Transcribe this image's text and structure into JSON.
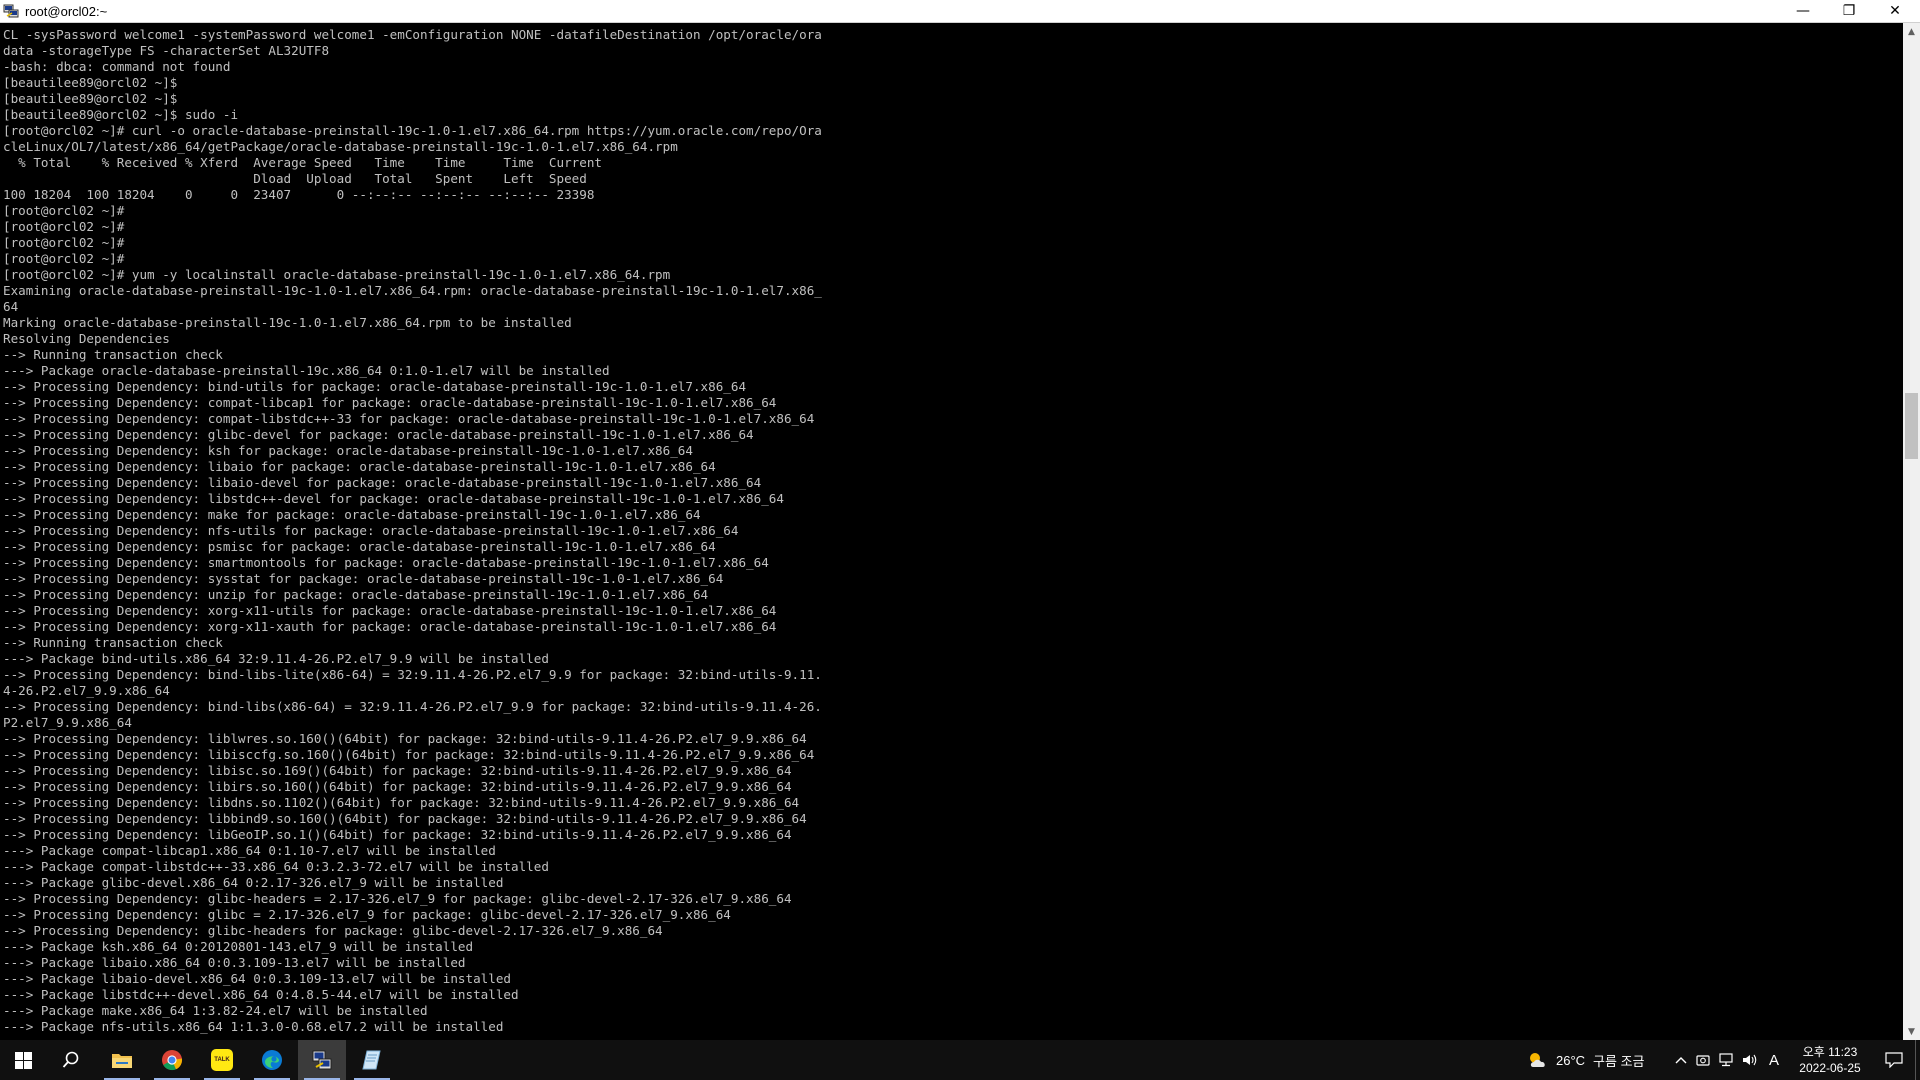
{
  "window": {
    "title": "root@orcl02:~",
    "minimize_glyph": "—",
    "maximize_glyph": "❐",
    "close_glyph": "✕"
  },
  "terminal": {
    "lines": [
      "CL -sysPassword welcome1 -systemPassword welcome1 -emConfiguration NONE -datafileDestination /opt/oracle/ora",
      "data -storageType FS -characterSet AL32UTF8",
      "-bash: dbca: command not found",
      "[beautilee89@orcl02 ~]$",
      "[beautilee89@orcl02 ~]$",
      "[beautilee89@orcl02 ~]$ sudo -i",
      "[root@orcl02 ~]# curl -o oracle-database-preinstall-19c-1.0-1.el7.x86_64.rpm https://yum.oracle.com/repo/Ora",
      "cleLinux/OL7/latest/x86_64/getPackage/oracle-database-preinstall-19c-1.0-1.el7.x86_64.rpm",
      "  % Total    % Received % Xferd  Average Speed   Time    Time     Time  Current",
      "                                 Dload  Upload   Total   Spent    Left  Speed",
      "100 18204  100 18204    0     0  23407      0 --:--:-- --:--:-- --:--:-- 23398",
      "[root@orcl02 ~]#",
      "[root@orcl02 ~]#",
      "[root@orcl02 ~]#",
      "[root@orcl02 ~]#",
      "[root@orcl02 ~]# yum -y localinstall oracle-database-preinstall-19c-1.0-1.el7.x86_64.rpm",
      "Examining oracle-database-preinstall-19c-1.0-1.el7.x86_64.rpm: oracle-database-preinstall-19c-1.0-1.el7.x86_",
      "64",
      "Marking oracle-database-preinstall-19c-1.0-1.el7.x86_64.rpm to be installed",
      "Resolving Dependencies",
      "--> Running transaction check",
      "---> Package oracle-database-preinstall-19c.x86_64 0:1.0-1.el7 will be installed",
      "--> Processing Dependency: bind-utils for package: oracle-database-preinstall-19c-1.0-1.el7.x86_64",
      "--> Processing Dependency: compat-libcap1 for package: oracle-database-preinstall-19c-1.0-1.el7.x86_64",
      "--> Processing Dependency: compat-libstdc++-33 for package: oracle-database-preinstall-19c-1.0-1.el7.x86_64",
      "--> Processing Dependency: glibc-devel for package: oracle-database-preinstall-19c-1.0-1.el7.x86_64",
      "--> Processing Dependency: ksh for package: oracle-database-preinstall-19c-1.0-1.el7.x86_64",
      "--> Processing Dependency: libaio for package: oracle-database-preinstall-19c-1.0-1.el7.x86_64",
      "--> Processing Dependency: libaio-devel for package: oracle-database-preinstall-19c-1.0-1.el7.x86_64",
      "--> Processing Dependency: libstdc++-devel for package: oracle-database-preinstall-19c-1.0-1.el7.x86_64",
      "--> Processing Dependency: make for package: oracle-database-preinstall-19c-1.0-1.el7.x86_64",
      "--> Processing Dependency: nfs-utils for package: oracle-database-preinstall-19c-1.0-1.el7.x86_64",
      "--> Processing Dependency: psmisc for package: oracle-database-preinstall-19c-1.0-1.el7.x86_64",
      "--> Processing Dependency: smartmontools for package: oracle-database-preinstall-19c-1.0-1.el7.x86_64",
      "--> Processing Dependency: sysstat for package: oracle-database-preinstall-19c-1.0-1.el7.x86_64",
      "--> Processing Dependency: unzip for package: oracle-database-preinstall-19c-1.0-1.el7.x86_64",
      "--> Processing Dependency: xorg-x11-utils for package: oracle-database-preinstall-19c-1.0-1.el7.x86_64",
      "--> Processing Dependency: xorg-x11-xauth for package: oracle-database-preinstall-19c-1.0-1.el7.x86_64",
      "--> Running transaction check",
      "---> Package bind-utils.x86_64 32:9.11.4-26.P2.el7_9.9 will be installed",
      "--> Processing Dependency: bind-libs-lite(x86-64) = 32:9.11.4-26.P2.el7_9.9 for package: 32:bind-utils-9.11.",
      "4-26.P2.el7_9.9.x86_64",
      "--> Processing Dependency: bind-libs(x86-64) = 32:9.11.4-26.P2.el7_9.9 for package: 32:bind-utils-9.11.4-26.",
      "P2.el7_9.9.x86_64",
      "--> Processing Dependency: liblwres.so.160()(64bit) for package: 32:bind-utils-9.11.4-26.P2.el7_9.9.x86_64",
      "--> Processing Dependency: libisccfg.so.160()(64bit) for package: 32:bind-utils-9.11.4-26.P2.el7_9.9.x86_64",
      "--> Processing Dependency: libisc.so.169()(64bit) for package: 32:bind-utils-9.11.4-26.P2.el7_9.9.x86_64",
      "--> Processing Dependency: libirs.so.160()(64bit) for package: 32:bind-utils-9.11.4-26.P2.el7_9.9.x86_64",
      "--> Processing Dependency: libdns.so.1102()(64bit) for package: 32:bind-utils-9.11.4-26.P2.el7_9.9.x86_64",
      "--> Processing Dependency: libbind9.so.160()(64bit) for package: 32:bind-utils-9.11.4-26.P2.el7_9.9.x86_64",
      "--> Processing Dependency: libGeoIP.so.1()(64bit) for package: 32:bind-utils-9.11.4-26.P2.el7_9.9.x86_64",
      "---> Package compat-libcap1.x86_64 0:1.10-7.el7 will be installed",
      "---> Package compat-libstdc++-33.x86_64 0:3.2.3-72.el7 will be installed",
      "---> Package glibc-devel.x86_64 0:2.17-326.el7_9 will be installed",
      "--> Processing Dependency: glibc-headers = 2.17-326.el7_9 for package: glibc-devel-2.17-326.el7_9.x86_64",
      "--> Processing Dependency: glibc = 2.17-326.el7_9 for package: glibc-devel-2.17-326.el7_9.x86_64",
      "--> Processing Dependency: glibc-headers for package: glibc-devel-2.17-326.el7_9.x86_64",
      "---> Package ksh.x86_64 0:20120801-143.el7_9 will be installed",
      "---> Package libaio.x86_64 0:0.3.109-13.el7 will be installed",
      "---> Package libaio-devel.x86_64 0:0.3.109-13.el7 will be installed",
      "---> Package libstdc++-devel.x86_64 0:4.8.5-44.el7 will be installed",
      "---> Package make.x86_64 1:3.82-24.el7 will be installed",
      "---> Package nfs-utils.x86_64 1:1.3.0-0.68.el7.2 will be installed"
    ]
  },
  "scrollbar": {
    "up_glyph": "▲",
    "down_glyph": "▼"
  },
  "taskbar": {
    "apps": [
      {
        "name": "start",
        "icon": "windows-logo-icon"
      },
      {
        "name": "search",
        "icon": "search-icon"
      },
      {
        "name": "file-explorer",
        "icon": "folder-icon"
      },
      {
        "name": "chrome",
        "icon": "chrome-icon"
      },
      {
        "name": "kakaotalk",
        "icon": "kakaotalk-icon"
      },
      {
        "name": "edge",
        "icon": "edge-icon"
      },
      {
        "name": "putty",
        "icon": "putty-icon"
      },
      {
        "name": "notepad",
        "icon": "notepad-icon"
      }
    ],
    "kakao_label": "TALK",
    "weather": {
      "temp": "26°C",
      "desc": "구름 조금"
    },
    "ime_indicator": "A",
    "clock": {
      "time": "오후 11:23",
      "date": "2022-06-25"
    }
  },
  "colors": {
    "terminal_bg": "#000000",
    "terminal_fg": "#c0c0c0",
    "taskbar_bg": "#101010",
    "titlebar_bg": "#ffffff"
  }
}
